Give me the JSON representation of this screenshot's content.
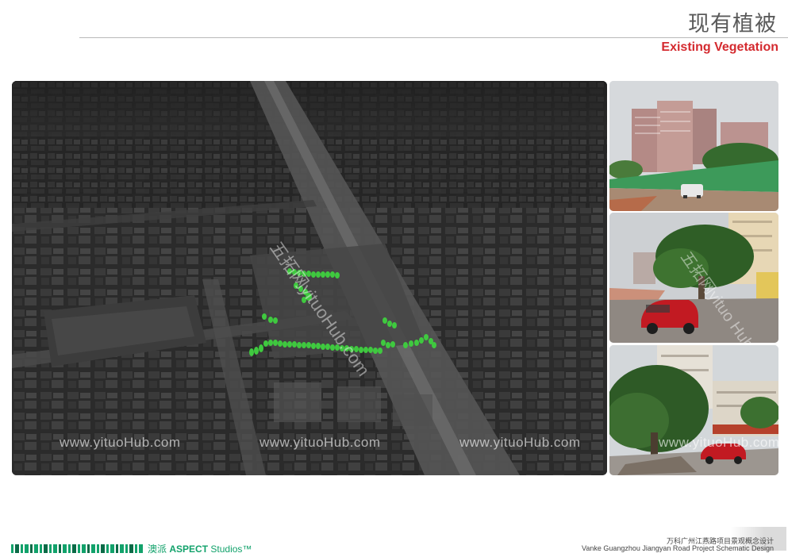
{
  "header": {
    "title_cn": "现有植被",
    "title_en": "Existing Vegetation"
  },
  "watermarks": {
    "domain": "www.yituoHub.com",
    "diagonal": "五拓网yituoHub.com",
    "diagonal_photo": "五拓网yituo Hub."
  },
  "aerial": {
    "tree_color": "#3fc93f"
  },
  "photos": [
    {
      "name": "site-photo-fence"
    },
    {
      "name": "site-photo-red-car"
    },
    {
      "name": "site-photo-trees"
    }
  ],
  "footer": {
    "logo_cn": "澳派",
    "logo_en": "ASPECT",
    "logo_studio": "Studios™",
    "project_cn": "万科广州江燕路项目景观概念设计",
    "project_en": "Vanke Guangzhou Jiangyan Road Project Schematic Design"
  },
  "colors": {
    "accent_red": "#d42a2f",
    "brand_green": "#12a26b"
  }
}
